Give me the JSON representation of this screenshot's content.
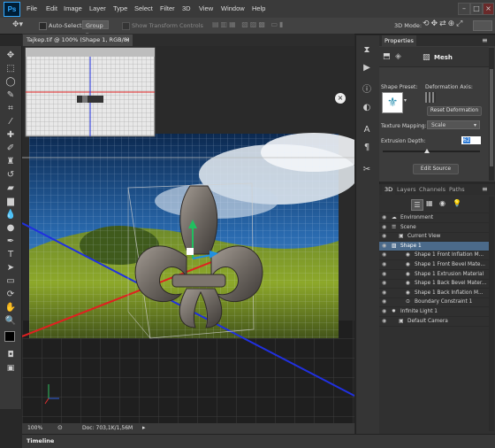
{
  "app": {
    "logo": "Ps"
  },
  "menu": [
    "File",
    "Edit",
    "Image",
    "Layer",
    "Type",
    "Select",
    "Filter",
    "3D",
    "View",
    "Window",
    "Help"
  ],
  "options": {
    "auto_select_label": "Auto-Select:",
    "auto_select_value": "Group",
    "transform_label": "Show Transform Controls",
    "mode_label": "3D Mode:"
  },
  "document": {
    "tab_title": "Tajkep.tif @ 100% (Shape 1, RGB/8) *",
    "close": "×"
  },
  "status": {
    "zoom": "100%",
    "doc_info": "Doc: 703,1K/1,56M"
  },
  "timeline": {
    "label": "Timeline"
  },
  "properties": {
    "tab": "Properties",
    "mesh_label": "Mesh",
    "shape_preset_label": "Shape Preset:",
    "deformation_axis_label": "Deformation Axis:",
    "reset_button": "Reset Deformation",
    "texture_mapping_label": "Texture Mapping:",
    "texture_mapping_value": "Scale",
    "extrusion_depth_label": "Extrusion Depth:",
    "extrusion_depth_value": "62",
    "edit_source_button": "Edit Source",
    "extrusion_slider": 0.45
  },
  "panel3d": {
    "tabs": [
      "3D",
      "Layers",
      "Channels",
      "Paths"
    ],
    "items": [
      {
        "name": "Environment",
        "indent": 0
      },
      {
        "name": "Scene",
        "indent": 0
      },
      {
        "name": "Current View",
        "indent": 1
      },
      {
        "name": "Shape 1",
        "indent": 0
      },
      {
        "name": "Shape 1 Front Inflation M...",
        "indent": 2
      },
      {
        "name": "Shape 1 Front Bevel Mate...",
        "indent": 2
      },
      {
        "name": "Shape 1 Extrusion Material",
        "indent": 2
      },
      {
        "name": "Shape 1 Back Bevel Mater...",
        "indent": 2
      },
      {
        "name": "Shape 1 Back Inflation M...",
        "indent": 2
      },
      {
        "name": "Boundary Constraint 1",
        "indent": 2
      },
      {
        "name": "Infinite Light 1",
        "indent": 0
      },
      {
        "name": "Default Camera",
        "indent": 1
      }
    ]
  },
  "colors": {
    "accent": "#31a8ff",
    "selected_row": "#4b6a8a",
    "panel_bg": "#3c3c3c"
  }
}
